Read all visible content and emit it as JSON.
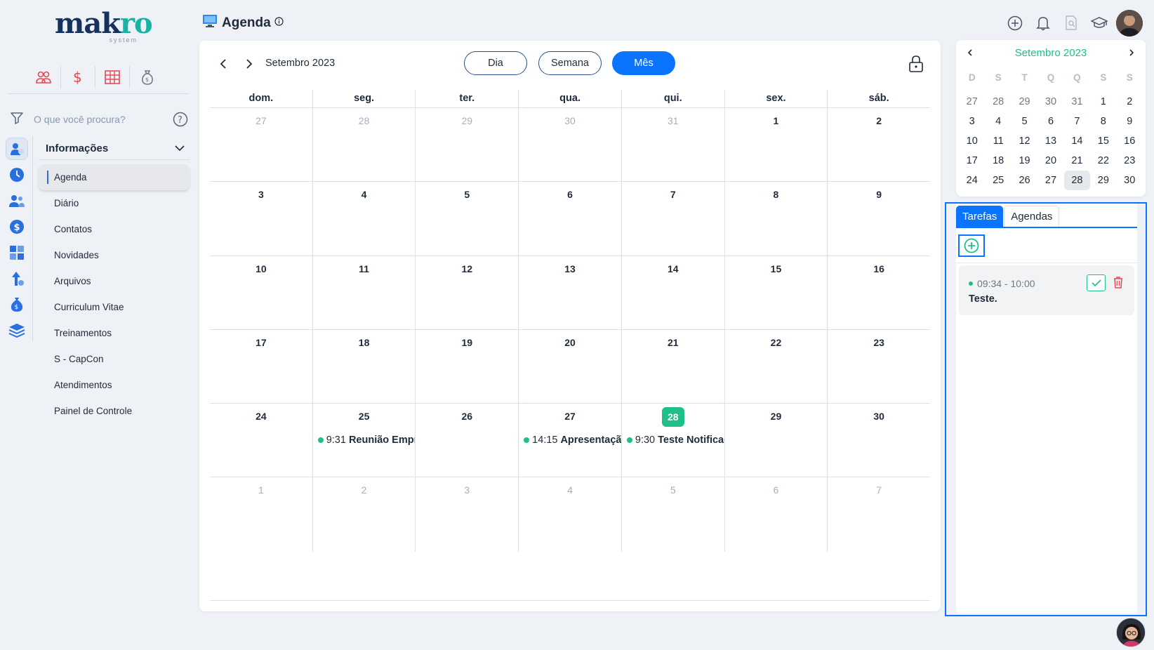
{
  "brand": {
    "name_left": "mak",
    "name_right": "ro",
    "sub": "system"
  },
  "sidebar": {
    "quick_icons": [
      {
        "icon": "users-icon",
        "color": "#e84855"
      },
      {
        "icon": "dollar-icon",
        "color": "#e84855"
      },
      {
        "icon": "spreadsheet-icon",
        "color": "#e84855"
      },
      {
        "icon": "money-bag-icon",
        "color": "#6f7887"
      }
    ],
    "search_placeholder": "O que você procura?",
    "section_title": "Informações",
    "items": [
      {
        "label": "Agenda",
        "active": true
      },
      {
        "label": "Diário"
      },
      {
        "label": "Contatos"
      },
      {
        "label": "Novidades"
      },
      {
        "label": "Arquivos"
      },
      {
        "label": "Curriculum Vitae"
      },
      {
        "label": "Treinamentos"
      },
      {
        "label": "S - CapCon"
      },
      {
        "label": "Atendimentos"
      },
      {
        "label": "Painel de Controle"
      }
    ]
  },
  "header": {
    "title": "Agenda"
  },
  "calendar": {
    "month_label": "Setembro 2023",
    "views": {
      "day": "Dia",
      "week": "Semana",
      "month": "Mês"
    },
    "active_view": "Mês",
    "weekdays": [
      "dom.",
      "seg.",
      "ter.",
      "qua.",
      "qui.",
      "sex.",
      "sáb."
    ],
    "weeks": [
      [
        {
          "n": "27",
          "o": true
        },
        {
          "n": "28",
          "o": true
        },
        {
          "n": "29",
          "o": true
        },
        {
          "n": "30",
          "o": true
        },
        {
          "n": "31",
          "o": true
        },
        {
          "n": "1"
        },
        {
          "n": "2"
        }
      ],
      [
        {
          "n": "3"
        },
        {
          "n": "4"
        },
        {
          "n": "5"
        },
        {
          "n": "6"
        },
        {
          "n": "7"
        },
        {
          "n": "8"
        },
        {
          "n": "9"
        }
      ],
      [
        {
          "n": "10"
        },
        {
          "n": "11"
        },
        {
          "n": "12"
        },
        {
          "n": "13"
        },
        {
          "n": "14"
        },
        {
          "n": "15"
        },
        {
          "n": "16"
        }
      ],
      [
        {
          "n": "17"
        },
        {
          "n": "18"
        },
        {
          "n": "19"
        },
        {
          "n": "20"
        },
        {
          "n": "21"
        },
        {
          "n": "22"
        },
        {
          "n": "23"
        }
      ],
      [
        {
          "n": "24"
        },
        {
          "n": "25",
          "event": {
            "time": "9:31",
            "title": "Reunião Empresa"
          }
        },
        {
          "n": "26"
        },
        {
          "n": "27",
          "event": {
            "time": "14:15",
            "title": "Apresentação"
          }
        },
        {
          "n": "28",
          "today": true,
          "event": {
            "time": "9:30",
            "title": "Teste Notificação"
          }
        },
        {
          "n": "29"
        },
        {
          "n": "30"
        }
      ],
      [
        {
          "n": "1",
          "o": true
        },
        {
          "n": "2",
          "o": true
        },
        {
          "n": "3",
          "o": true
        },
        {
          "n": "4",
          "o": true
        },
        {
          "n": "5",
          "o": true
        },
        {
          "n": "6",
          "o": true
        },
        {
          "n": "7",
          "o": true
        }
      ]
    ]
  },
  "mini_calendar": {
    "title": "Setembro 2023",
    "weekdays": [
      "D",
      "S",
      "T",
      "Q",
      "Q",
      "S",
      "S"
    ],
    "weeks": [
      [
        "27",
        "28",
        "29",
        "30",
        "31",
        "1",
        "2"
      ],
      [
        "3",
        "4",
        "5",
        "6",
        "7",
        "8",
        "9"
      ],
      [
        "10",
        "11",
        "12",
        "13",
        "14",
        "15",
        "16"
      ],
      [
        "17",
        "18",
        "19",
        "20",
        "21",
        "22",
        "23"
      ],
      [
        "24",
        "25",
        "26",
        "27",
        "28",
        "29",
        "30"
      ]
    ],
    "selected": "28"
  },
  "tasks": {
    "tabs": [
      "Tarefas",
      "Agendas"
    ],
    "active_tab": "Tarefas",
    "items": [
      {
        "time": "09:34 - 10:00",
        "title": "Teste."
      }
    ]
  },
  "colors": {
    "accent": "#0b74ff",
    "success": "#1ec087",
    "danger": "#e84855",
    "brand_dark": "#16325c"
  }
}
